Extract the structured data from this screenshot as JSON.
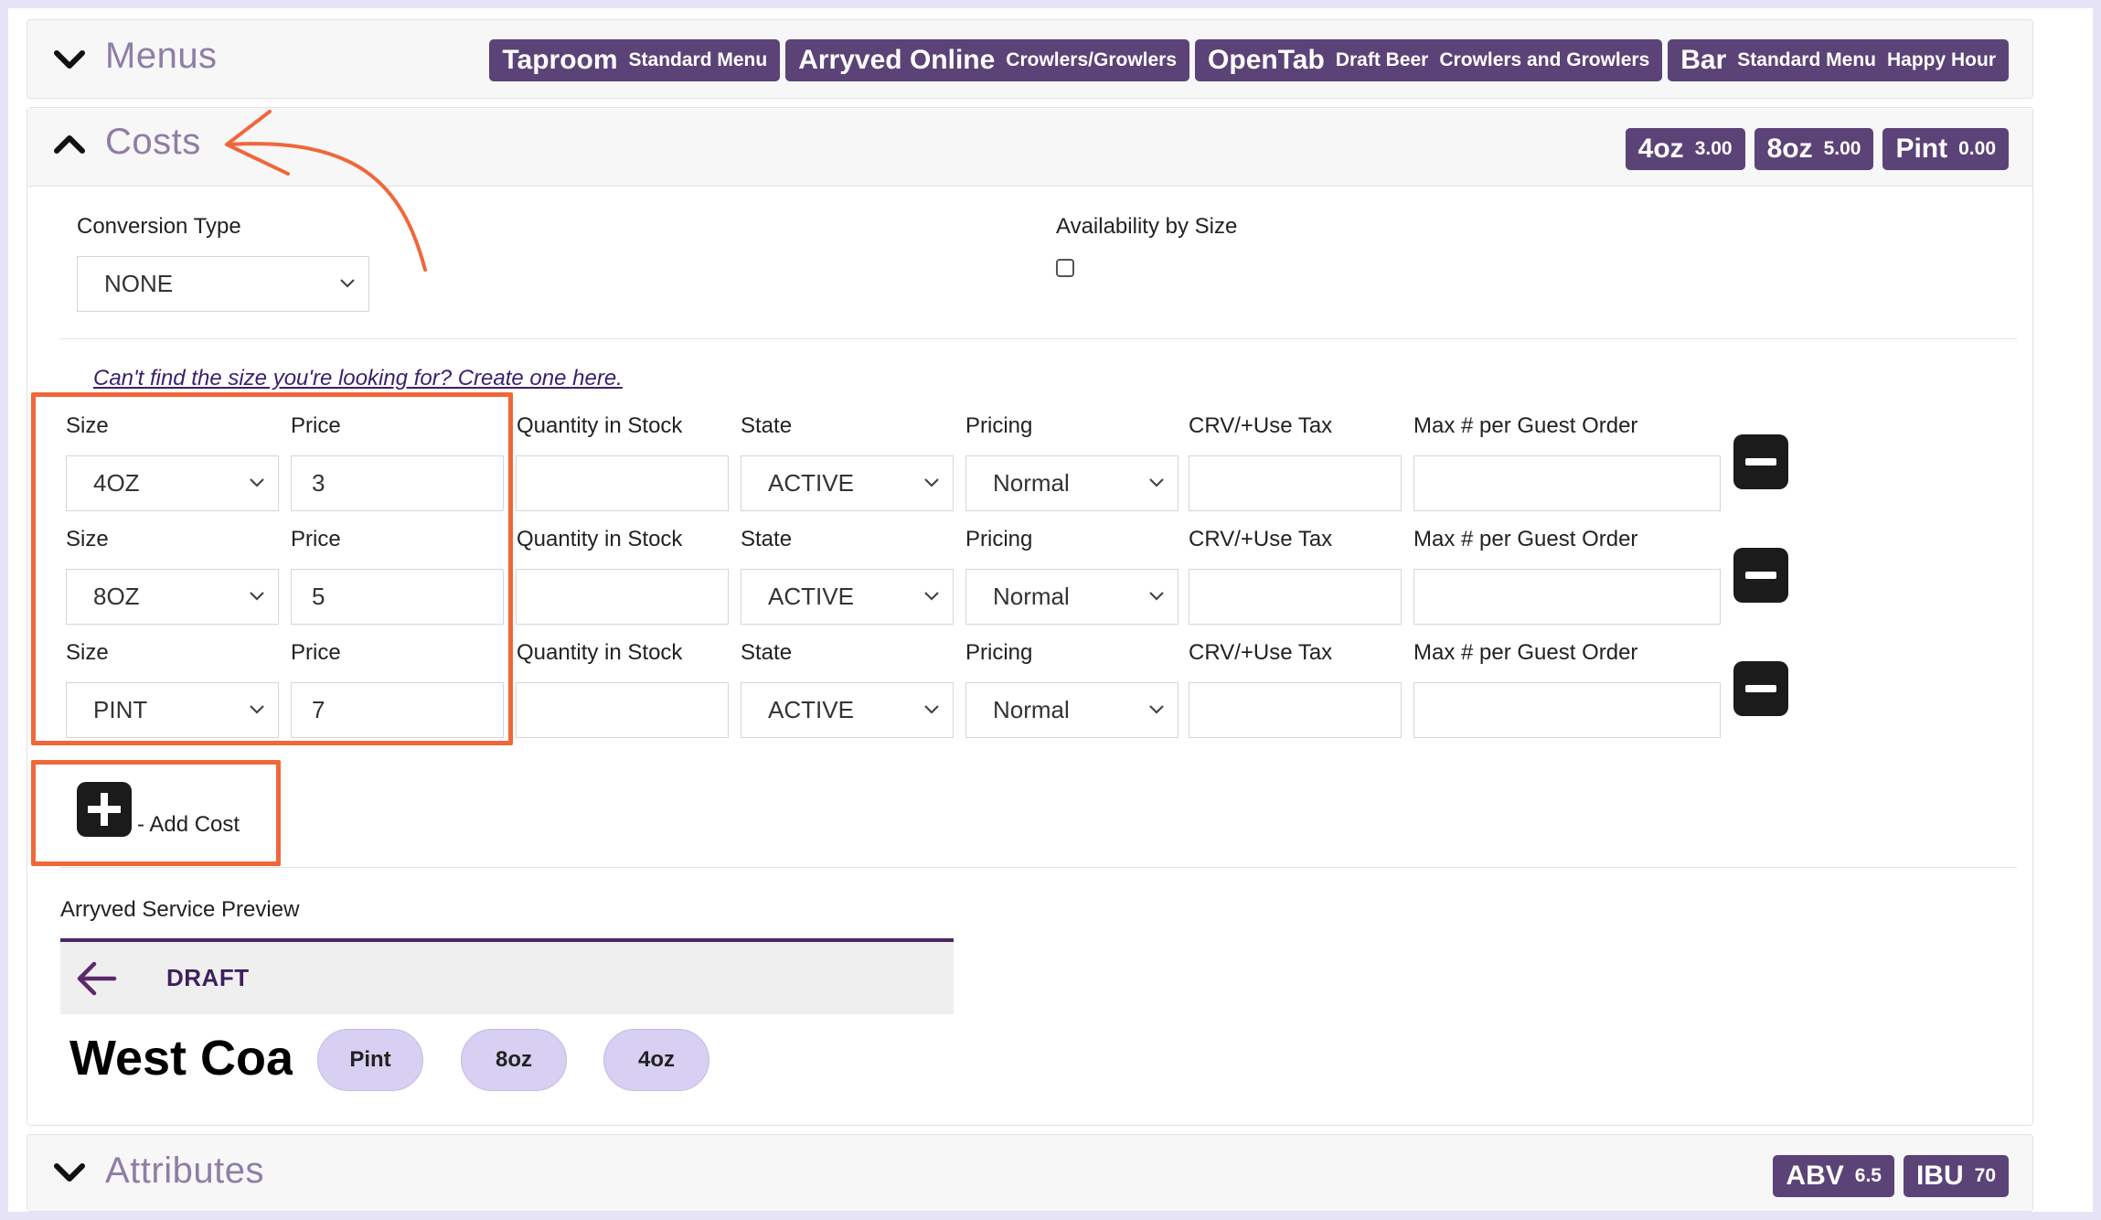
{
  "menus": {
    "title": "Menus",
    "badges": [
      {
        "name": "Taproom",
        "items": [
          "Standard Menu"
        ]
      },
      {
        "name": "Arryved Online",
        "items": [
          "Crowlers/Growlers"
        ]
      },
      {
        "name": "OpenTab",
        "items": [
          "Draft Beer",
          "Crowlers and Growlers"
        ]
      },
      {
        "name": "Bar",
        "items": [
          "Standard Menu",
          "Happy Hour"
        ]
      }
    ]
  },
  "costs": {
    "title": "Costs",
    "badges": [
      {
        "size": "4oz",
        "price": "3.00"
      },
      {
        "size": "8oz",
        "price": "5.00"
      },
      {
        "size": "Pint",
        "price": "0.00"
      }
    ],
    "conversion_type_label": "Conversion Type",
    "conversion_type_value": "NONE",
    "availability_label": "Availability by Size",
    "create_size_link": "Can't find the size you're looking for? Create one here.",
    "columns": {
      "size": "Size",
      "price": "Price",
      "quantity": "Quantity in Stock",
      "state": "State",
      "pricing": "Pricing",
      "crv": "CRV/+Use Tax",
      "max": "Max # per Guest Order"
    },
    "rows": [
      {
        "size": "4OZ",
        "price": "3",
        "quantity": "",
        "state": "ACTIVE",
        "pricing": "Normal",
        "crv": "",
        "max": ""
      },
      {
        "size": "8OZ",
        "price": "5",
        "quantity": "",
        "state": "ACTIVE",
        "pricing": "Normal",
        "crv": "",
        "max": ""
      },
      {
        "size": "PINT",
        "price": "7",
        "quantity": "",
        "state": "ACTIVE",
        "pricing": "Normal",
        "crv": "",
        "max": ""
      }
    ],
    "add_cost_label": "- Add Cost"
  },
  "preview": {
    "title": "Arryved Service Preview",
    "category": "DRAFT",
    "beer_name": "West Coast",
    "sizes": [
      "Pint",
      "8oz",
      "4oz"
    ]
  },
  "attributes": {
    "title": "Attributes",
    "badges": [
      {
        "name": "ABV",
        "value": "6.5"
      },
      {
        "name": "IBU",
        "value": "70"
      }
    ]
  },
  "colors": {
    "badge_bg": "#5b4377",
    "title_color": "#8e7ea6",
    "highlight": "#f0673a",
    "pill_bg": "#d8d0f2"
  },
  "icons": {
    "collapse": "chevron-up-icon",
    "expand": "chevron-down-icon",
    "remove": "minus-icon",
    "add": "plus-icon",
    "back": "arrow-left-icon"
  }
}
